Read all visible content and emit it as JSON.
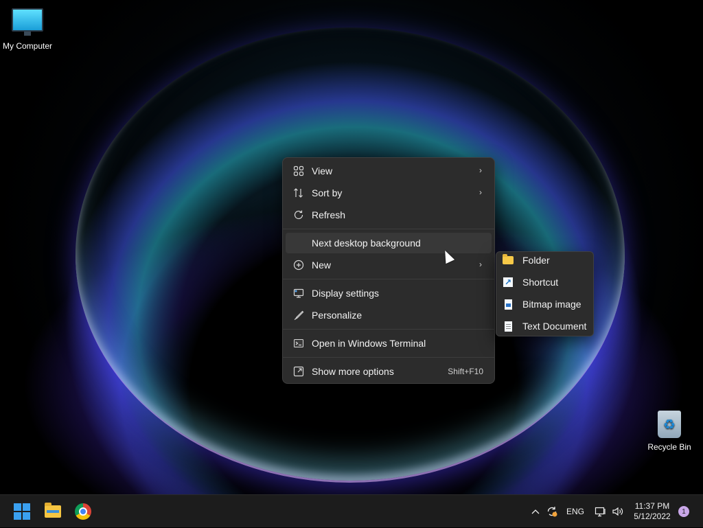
{
  "desktop": {
    "icons": [
      {
        "label": "My Computer"
      },
      {
        "label": "Recycle Bin"
      }
    ]
  },
  "context_menu": {
    "items": [
      {
        "label": "View",
        "icon": "grid-icon",
        "has_submenu": true
      },
      {
        "label": "Sort by",
        "icon": "sort-icon",
        "has_submenu": true
      },
      {
        "label": "Refresh",
        "icon": "refresh-icon"
      },
      {
        "label": "Next desktop background"
      },
      {
        "label": "New",
        "icon": "plus-circle-icon",
        "has_submenu": true
      },
      {
        "label": "Display settings",
        "icon": "display-icon"
      },
      {
        "label": "Personalize",
        "icon": "brush-icon"
      },
      {
        "label": "Open in Windows Terminal",
        "icon": "terminal-icon"
      },
      {
        "label": "Show more options",
        "icon": "expand-icon",
        "shortcut": "Shift+F10"
      }
    ]
  },
  "new_submenu": {
    "items": [
      {
        "label": "Folder",
        "icon": "folder-icon"
      },
      {
        "label": "Shortcut",
        "icon": "shortcut-icon"
      },
      {
        "label": "Bitmap image",
        "icon": "bitmap-icon"
      },
      {
        "label": "Text Document",
        "icon": "text-document-icon"
      }
    ]
  },
  "taskbar": {
    "tray": {
      "language": "ENG",
      "time": "11:37 PM",
      "date": "5/12/2022",
      "notification_count": "1"
    }
  },
  "colors": {
    "menu_bg": "#2c2c2c",
    "taskbar_bg": "#1c1c1c",
    "accent": "#3aa0f0"
  }
}
